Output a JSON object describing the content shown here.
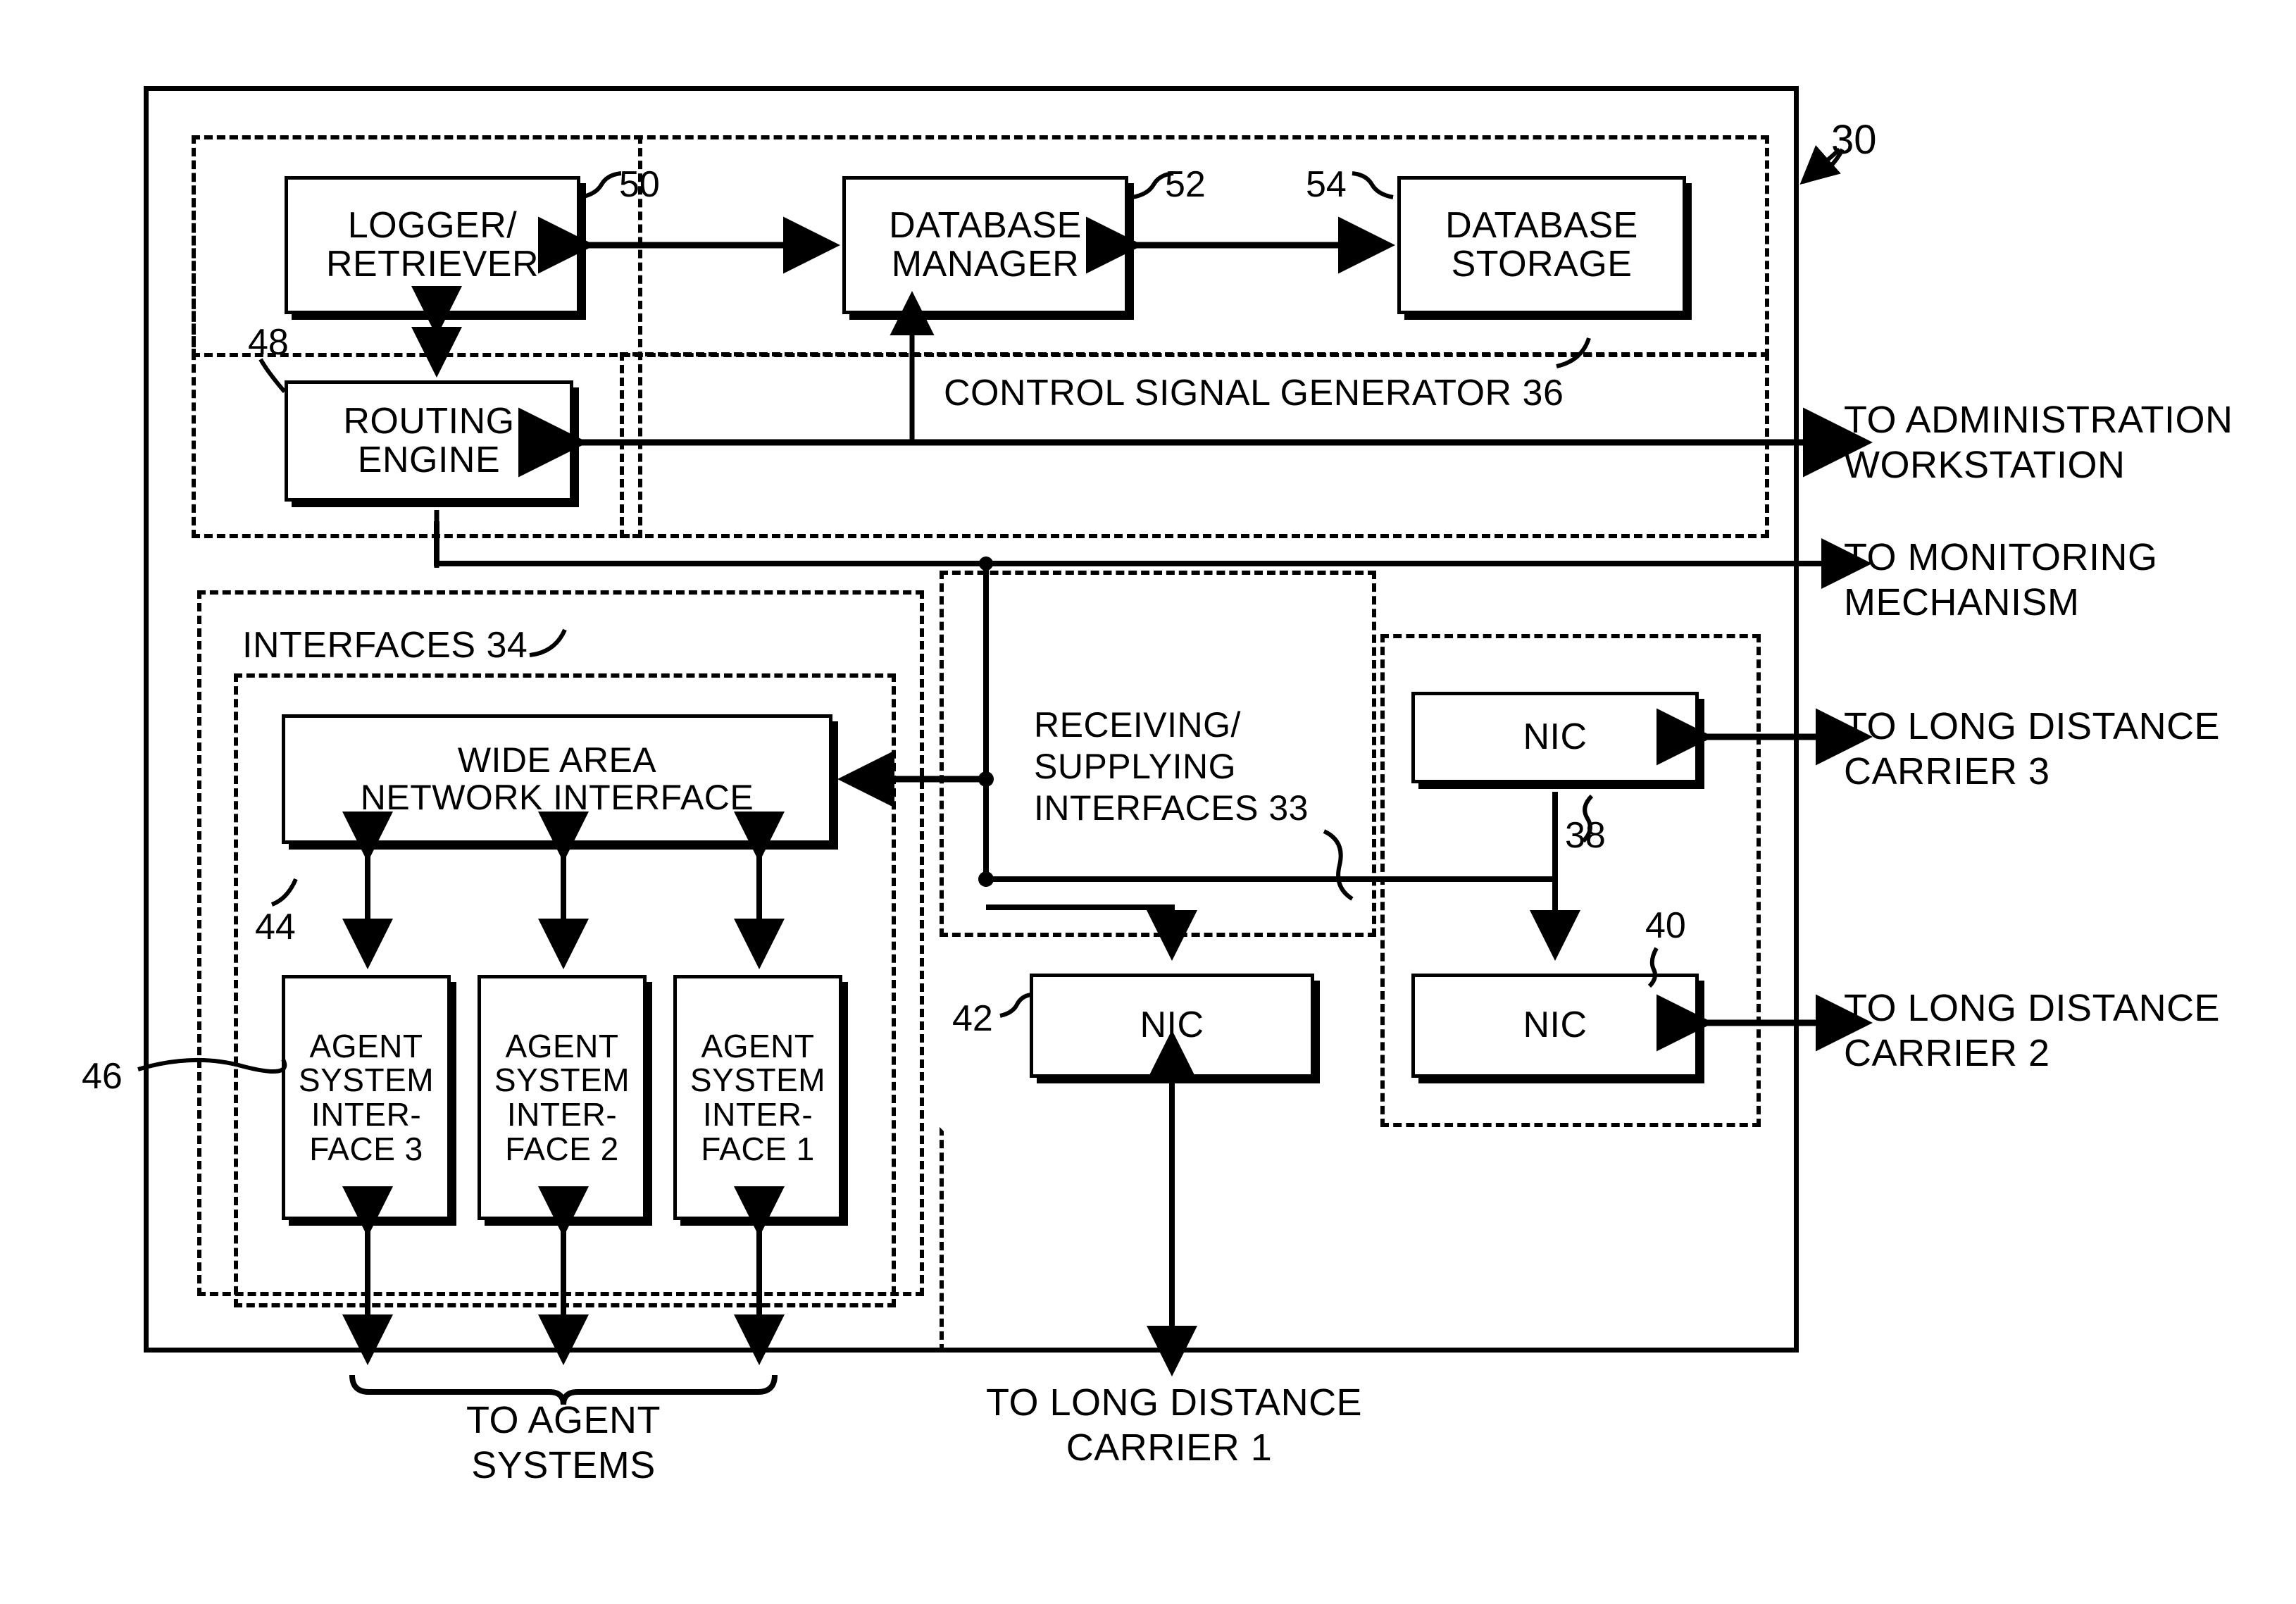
{
  "figure": {
    "system_ref": "30",
    "boxes": {
      "logger_retriever": "LOGGER/\nRETRIEVER",
      "logger_retriever_ref": "50",
      "database_manager": "DATABASE\nMANAGER",
      "database_manager_ref": "52",
      "database_storage": "DATABASE\nSTORAGE",
      "database_storage_ref": "54",
      "routing_engine": "ROUTING\nENGINE",
      "routing_engine_ref": "48",
      "wide_area_network_interface": "WIDE AREA\nNETWORK INTERFACE",
      "wide_area_network_interface_ref": "44",
      "agent_system_interface_3": "AGENT\nSYSTEM\nINTER-\nFACE 3",
      "agent_system_interface_2": "AGENT\nSYSTEM\nINTER-\nFACE 2",
      "agent_system_interface_1": "AGENT\nSYSTEM\nINTER-\nFACE 1",
      "agent_system_interfaces_ref": "46",
      "nic_top_right": "NIC",
      "nic_top_right_ref": "38",
      "nic_bottom_left": "NIC",
      "nic_bottom_left_ref": "42",
      "nic_bottom_right": "NIC",
      "nic_bottom_right_ref": "40"
    },
    "group_labels": {
      "control_signal_generator": "CONTROL SIGNAL GENERATOR 36",
      "interfaces": "INTERFACES 34",
      "receiving_supplying_interfaces": "RECEIVING/\nSUPPLYING\nINTERFACES 33"
    },
    "external_labels": {
      "to_administration_workstation": "TO ADMINISTRATION\nWORKSTATION",
      "to_monitoring_mechanism": "TO MONITORING\nMECHANISM",
      "to_long_distance_carrier_3": "TO LONG DISTANCE\nCARRIER 3",
      "to_long_distance_carrier_2": "TO LONG DISTANCE\nCARRIER 2",
      "to_long_distance_carrier_1": "TO LONG DISTANCE\nCARRIER 1",
      "to_agent_systems": "TO AGENT\nSYSTEMS"
    }
  }
}
